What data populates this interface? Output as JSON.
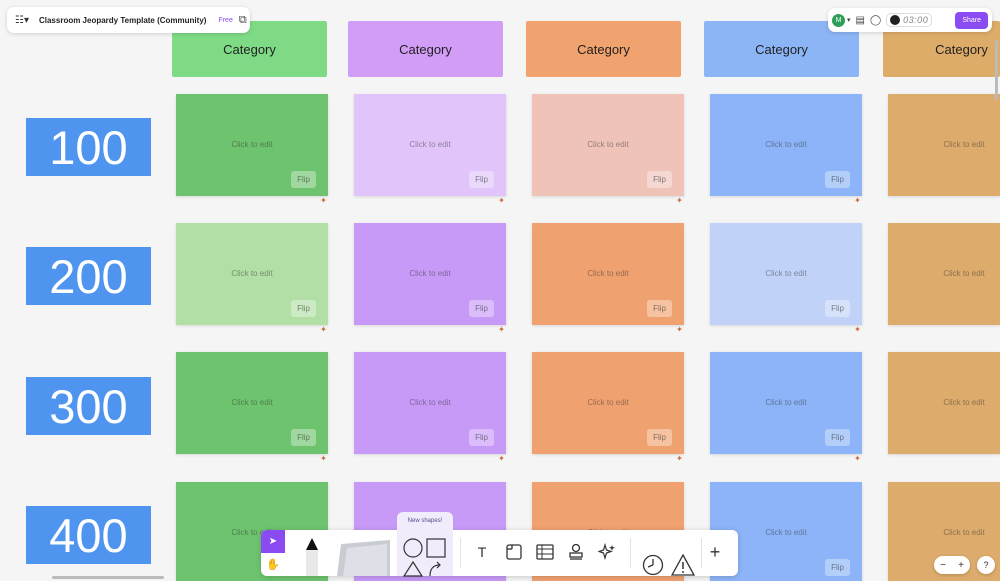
{
  "header": {
    "title": "Classroom Jeopardy Template (Community)",
    "badge": "Free",
    "menu_icon": "board-menu-icon",
    "duplicate_icon": "duplicate-icon"
  },
  "topright": {
    "avatar_initial": "M",
    "timer_text": "03:00",
    "share_label": "Share"
  },
  "board": {
    "categories": [
      {
        "label": "Category",
        "color": "#7fda86"
      },
      {
        "label": "Category",
        "color": "#d29df7"
      },
      {
        "label": "Category",
        "color": "#f0a26f"
      },
      {
        "label": "Category",
        "color": "#8cb5f6"
      },
      {
        "label": "Category",
        "color": "#ddac68"
      }
    ],
    "points": [
      "100",
      "200",
      "300",
      "400"
    ],
    "card_text": "Click to edit",
    "flip_label": "Flip",
    "rows": [
      [
        "#6ec46e",
        "#e1c5fa",
        "#efc3b8",
        "#8db4f8",
        "#ddab6b"
      ],
      [
        "#b1dfa5",
        "#c79af7",
        "#f0a170",
        "#c0d2f8",
        "#ddab6b"
      ],
      [
        "#6ec46e",
        "#c79af7",
        "#f0a170",
        "#8db4f8",
        "#ddab6b"
      ],
      [
        "#6ec46e",
        "#c79af7",
        "#f0a170",
        "#8db4f8",
        "#ddab6b"
      ]
    ]
  },
  "toolbar": {
    "new_shapes_label": "New shapes!",
    "text_tool": "T",
    "add": "+"
  },
  "zoom": {
    "minus": "−",
    "plus": "+",
    "help": "?"
  }
}
